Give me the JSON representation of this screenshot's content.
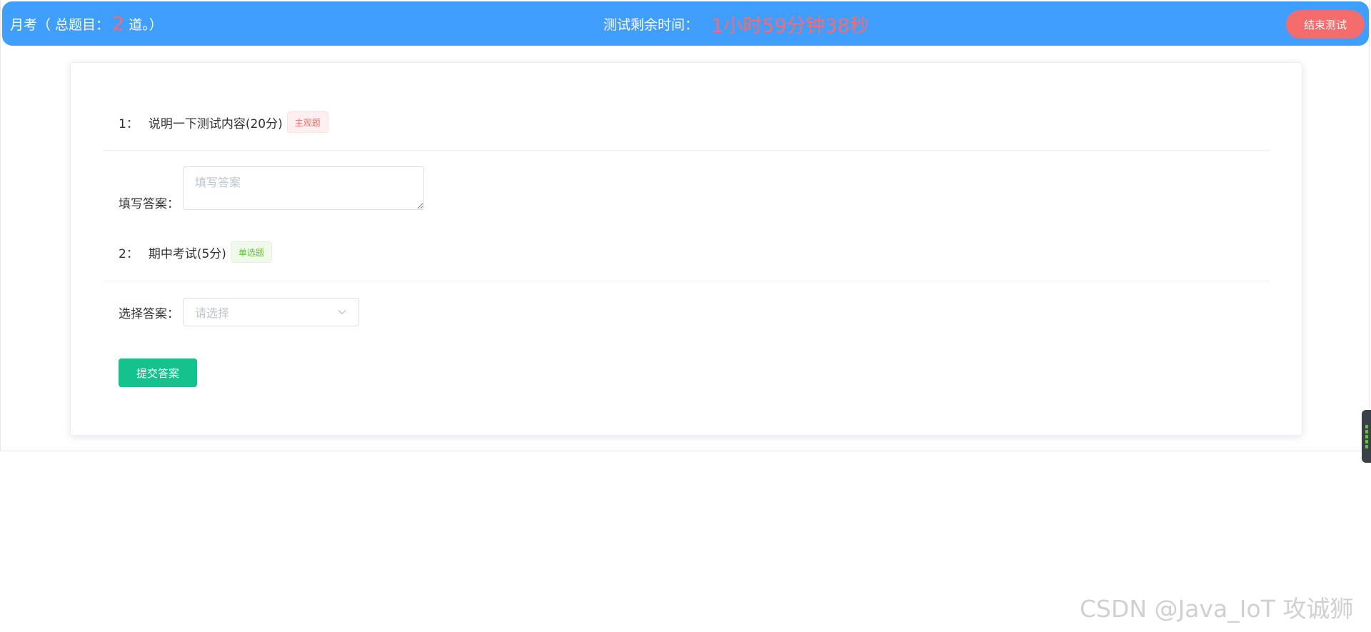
{
  "header": {
    "exam_name": "月考",
    "total_prefix": "（ 总题目：",
    "total_count": "2",
    "total_suffix": "道。）",
    "timer_label": "测试剩余时间：",
    "timer_value": "1小时59分钟38秒",
    "end_button_label": "结束测试"
  },
  "questions": [
    {
      "number": "1：",
      "title": "说明一下测试内容(20分)",
      "type_tag": "主观题",
      "answer_label": "填写答案：",
      "answer_placeholder": "填写答案",
      "answer_value": ""
    },
    {
      "number": "2：",
      "title": "期中考试(5分)",
      "type_tag": "单选题",
      "answer_label": "选择答案：",
      "select_placeholder": "请选择",
      "selected_value": ""
    }
  ],
  "submit_button_label": "提交答案",
  "watermark": "CSDN @Java_IoT 攻诚狮",
  "colors": {
    "header_bg": "#409eff",
    "accent_red": "#f56c6c",
    "submit_green": "#13c28c",
    "tag_success": "#67c23a"
  },
  "icons": {
    "select_chevron": "chevron-down-icon"
  }
}
